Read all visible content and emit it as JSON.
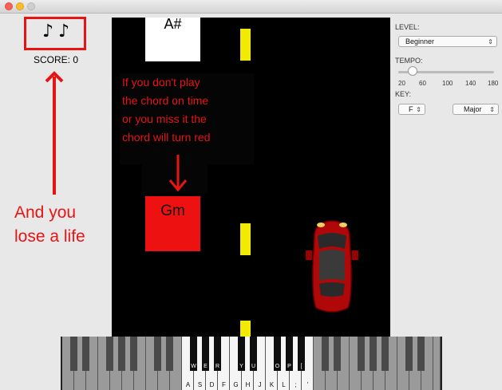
{
  "window": {
    "title": ""
  },
  "lives": {
    "icons": [
      "♪",
      "♪"
    ]
  },
  "score": {
    "text": "SCORE: 0"
  },
  "annotations": {
    "left": "And you lose a life",
    "center": [
      "If you don't play",
      "the chord on time",
      "or you miss it the",
      "chord will turn red"
    ]
  },
  "road": {
    "chords": [
      {
        "label": "A#",
        "state": "upcoming",
        "color": "#ffffff"
      },
      {
        "label": "Gm",
        "state": "missed",
        "color": "#ee1111"
      }
    ]
  },
  "controls": {
    "level_label": "LEVEL:",
    "level_value": "Beginner",
    "tempo_label": "TEMPO:",
    "tempo_value": 35,
    "tempo_ticks": [
      "20",
      "60",
      "100",
      "140",
      "180"
    ],
    "key_label": "KEY:",
    "key_note": "F",
    "key_mode": "Major"
  },
  "piano": {
    "white_labels": [
      "A",
      "S",
      "D",
      "F",
      "G",
      "H",
      "J",
      "K",
      "L",
      ";",
      "'"
    ],
    "black_labels": [
      "W",
      "E",
      "R",
      "Y",
      "U",
      "O",
      "P",
      "["
    ]
  },
  "colors": {
    "accent": "#e81414",
    "road": "#000000",
    "lane": "#f2ea00",
    "car": "#b00808"
  }
}
